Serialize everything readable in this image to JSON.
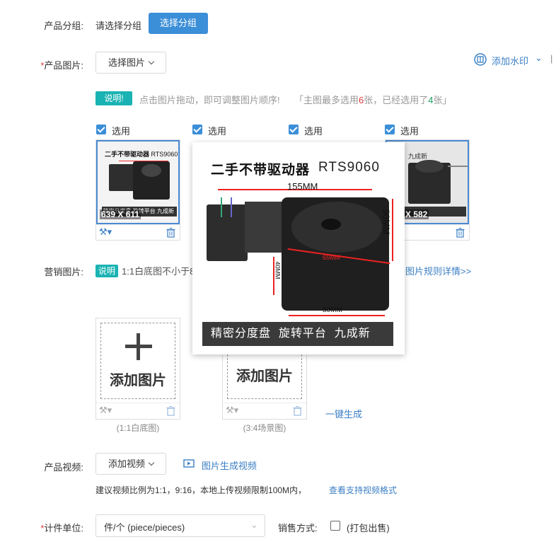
{
  "group": {
    "label": "产品分组:",
    "placeholder_text": "请选择分组",
    "button": "选择分组"
  },
  "images": {
    "label": "产品图片:",
    "select_button": "选择图片",
    "watermark_button": "添加水印",
    "tip_tag": "说明!",
    "tip_text": "点击图片拖动，即可调整图片顺序!",
    "count_prefix": "「主图最多选用",
    "count_max": "6",
    "count_mid": "张，已经选用了",
    "count_used": "4",
    "count_suffix": "张」",
    "select_label": "选用",
    "thumb1_dim": "639 X 611",
    "thumb4_dim": "X 582"
  },
  "product_photo": {
    "title_cn": "二手不带驱动器",
    "model": "RTS9060",
    "dim_top": "155MM",
    "dim_side": "90MM",
    "dim_inner": "65MM",
    "dim_height": "40MM",
    "dim_base": "80MM",
    "caption": "精密分度盘  旋转平台  九成新",
    "thumb_caption": "精密分度盘 旋转平台 九成新",
    "thumb4_new": "九成新"
  },
  "marketing": {
    "label": "营销图片:",
    "tip_tag": "说明",
    "tip_text": "1:1白底图不小于8",
    "rules_link": "图片规则详情>>",
    "add_label": "添加图片",
    "card1_caption": "(1:1白底图)",
    "card2_caption": "(3:4场景图)",
    "generate_link": "一键生成"
  },
  "video": {
    "label": "产品视频:",
    "add_button": "添加视频",
    "generate_link": "图片生成视频",
    "hint": "建议视频比例为1:1，9:16，本地上传视频限制100M内，",
    "formats_link": "查看支持视频格式"
  },
  "unit": {
    "label": "计件单位:",
    "value": "件/个 (piece/pieces)",
    "sale_label": "销售方式:",
    "sale_option": "(打包出售)"
  },
  "colors": {
    "primary": "#3b8ed8",
    "teal": "#1ab3b3",
    "required": "#e4393c",
    "link": "#3b7fc4"
  }
}
